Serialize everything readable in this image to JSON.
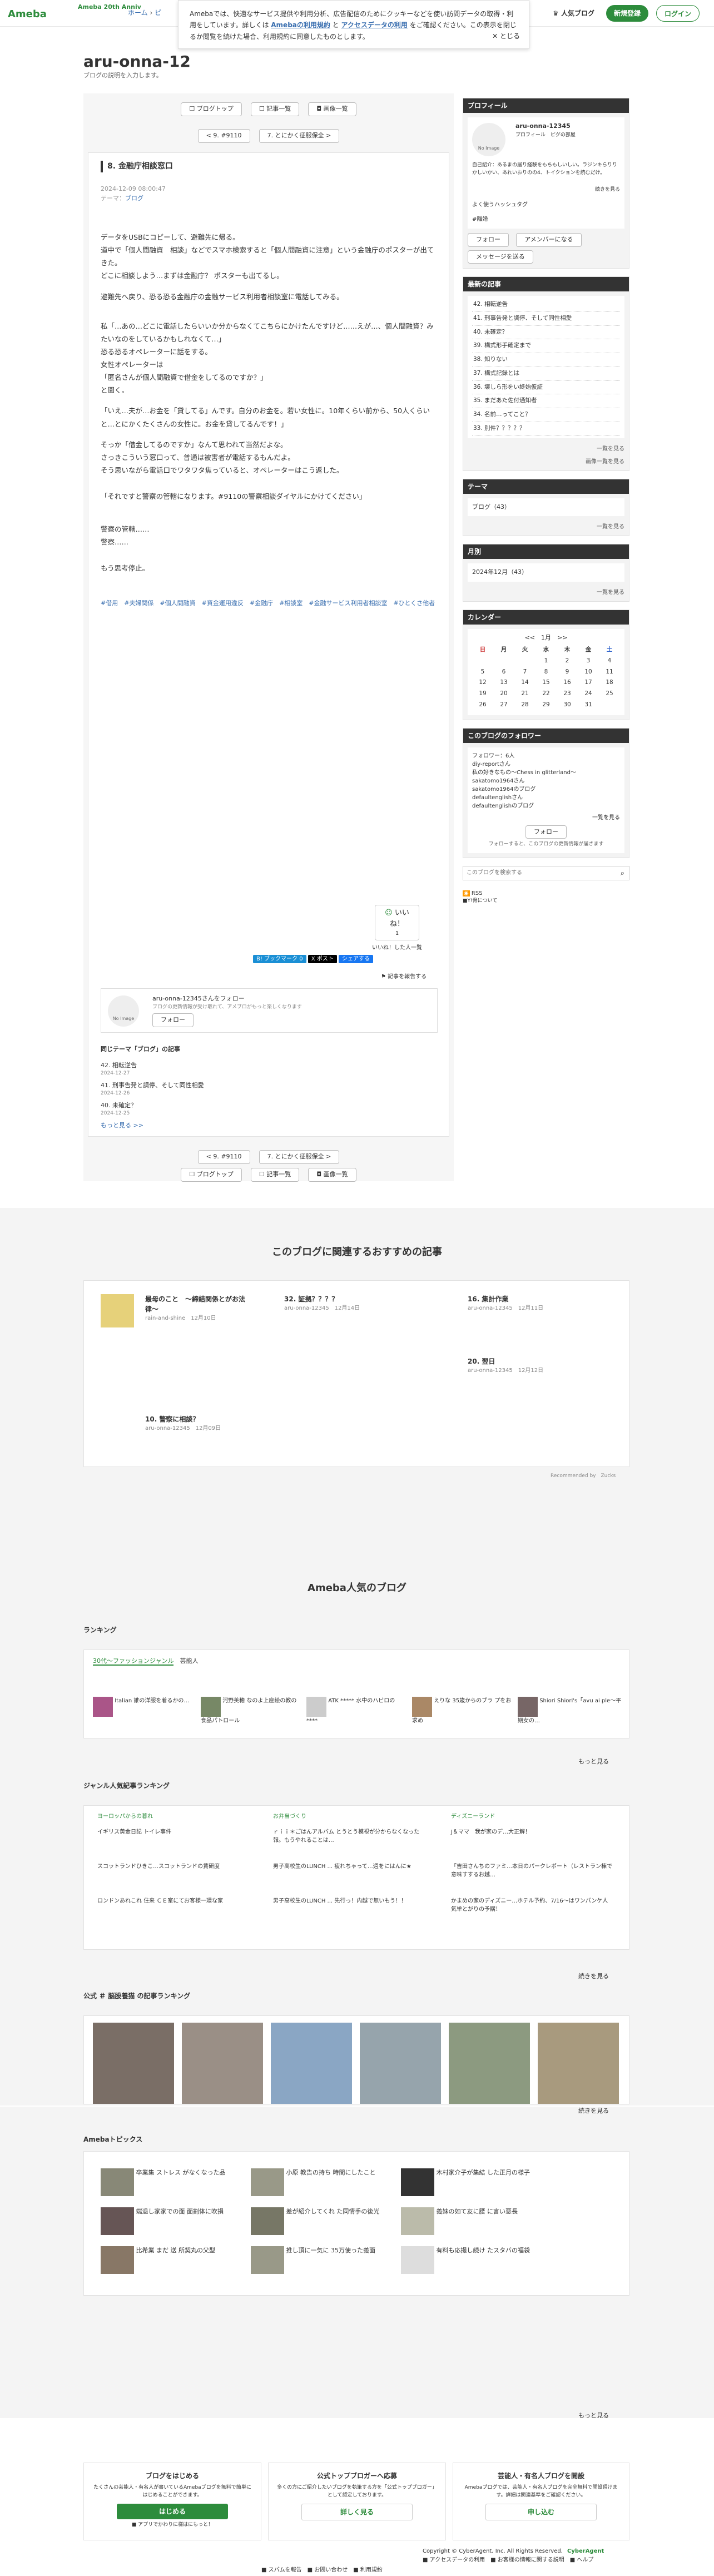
{
  "header": {
    "logo": "Ameba",
    "anniv": "Ameba 20th Anniv",
    "crumb_home": "ホーム",
    "crumb_more": "ピ",
    "btn_popular": "人気ブログ",
    "btn_signup": "新規登録",
    "btn_login": "ログイン"
  },
  "cookie": {
    "text_pre": "Amebaでは、快適なサービス提供や利用分析、広告配信のためにクッキーなどを使い訪問データの取得・利用をしています。詳しくは ",
    "link1": "Amebaの利用規約",
    "mid": " と ",
    "link2": "アクセスデータの利用",
    "text_post": " をご確認ください。この表示を閉じるか閲覧を続けた場合、利用規約に同意したものとします。",
    "close": "とじる"
  },
  "blog": {
    "title": "aru-onna-12",
    "desc": "ブログの説明を入力します。"
  },
  "nav": {
    "top": "ブログトップ",
    "list": "記事一覧",
    "images": "画像一覧",
    "prev": "< 9. #9110",
    "next": "7. とにかく征服保全 >"
  },
  "article": {
    "title": "8. 金融庁相談窓口",
    "date": "2024-12-09 08:00:47",
    "theme": "テーマ：",
    "theme_link": "ブログ",
    "p1": "データをUSBにコピーして、避難先に帰る。",
    "p2": "道中で「個人間融資　相談」などでスマホ検索すると「個人間融資に注意」という金融庁のポスターが出てきた。",
    "p3": "どこに相談しよう…まずは金融庁？ ポスターも出てるし。",
    "p4": "避難先へ戻り、恐る恐る金融庁の金融サービス利用者相談室に電話してみる。",
    "p5": "私「…あの…どこに電話したらいいか分からなくてこちらにかけたんですけど……えが…、個人間融資？みたいなのをしているかもしれなくて…」",
    "p6": "恐る恐るオペレーターに話をする。",
    "p7": "女性オペレーターは",
    "p8": "「匿名さんが個人間融資で借金をしてるのですか？」",
    "p9": "と聞く。",
    "p10": "「いえ…夫が…お金を「貸してる」んです。自分のお金を。若い女性に。10年くらい前から、50人くらいと…とにかくたくさんの女性に。お金を貸してるんです！」",
    "p11": "そっか「借金してるのですか」なんて思われて当然だよな。",
    "p12": "さっきこういう窓口って、普通は被害者が電話するもんだよ。",
    "p13": "そう思いながら電話口でワタワタ焦っていると、オペレーターはこう返した。",
    "p14": "「それですと警察の管轄になります。#9110の警察相談ダイヤルにかけてください」",
    "p15": "警察の管轄……",
    "p16": "警察……",
    "p17": "もう思考停止。",
    "tags": "#借用　#夫婦関係　#個人間融資　#資金運用違反　#金融庁　#相談室　#金融サービス利用者相談室　#ひとくさ他者",
    "like": "いいね！",
    "like_count": "1",
    "like_list": "いいね！した人一覧",
    "share1": "B! ブックマーク 0",
    "share2": "X ポスト",
    "share3": "シェアする",
    "report": "記事を報告する",
    "follow_text": "aru-onna-12345さんをフォロー",
    "follow_sub": "ブログの更新情報が受け取れて、アメブロがもっと楽しくなります",
    "follow_btn": "フォロー",
    "same_theme": "同じテーマ「ブログ」の記事",
    "rel": [
      {
        "t": "42. 相転逆告",
        "d": "2024-12-27"
      },
      {
        "t": "41. 刑事告発と調停、そして同性相愛",
        "d": "2024-12-26"
      },
      {
        "t": "40. 未確定？",
        "d": "2024-12-25"
      }
    ],
    "rel_more": "もっと見る >>"
  },
  "side": {
    "profile_h": "プロフィール",
    "user": "aru-onna-12345",
    "noimg": "No Image",
    "prof_links": "プロフィール　ピグの部屋",
    "intro": "自己紹介：あるまの居り経験をもちもしいしい。ラジンキらりりかしいかい、あれいおりのの4、トイクションを読むだけ。",
    "intro_more": "続きを見る",
    "hashtag": "よく使うハッシュタグ",
    "tag1": "#離婚",
    "btn_follow": "フォロー",
    "btn_amember": "アメンバーになる",
    "btn_msg": "メッセージを送る",
    "recent_h": "最新の記事",
    "recent": [
      "42. 相転逆告",
      "41. 刑事告発と調停、そして同性相愛",
      "40. 未確定？",
      "39. 構式形手確定まで",
      "38. 知りない",
      "37. 構式記録とは",
      "36. 壊しら形をい終始仮証",
      "35. まだあた佐付通知者",
      "34. 名前…ってこと？",
      "33. 別件？？？？？"
    ],
    "recent_more": "一覧を見る",
    "image_more": "画像一覧を見る",
    "theme_h": "テーマ",
    "theme_item": "ブログ（43）",
    "month_h": "月別",
    "month_item": "2024年12月（43）",
    "cal_h": "カレンダー",
    "cal_title": "<<　1月　>>",
    "cal_days": [
      "日",
      "月",
      "火",
      "水",
      "木",
      "金",
      "土"
    ],
    "cal_rows": [
      [
        "",
        "",
        "",
        "1",
        "2",
        "3",
        "4"
      ],
      [
        "5",
        "6",
        "7",
        "8",
        "9",
        "10",
        "11"
      ],
      [
        "12",
        "13",
        "14",
        "15",
        "16",
        "17",
        "18"
      ],
      [
        "19",
        "20",
        "21",
        "22",
        "23",
        "24",
        "25"
      ],
      [
        "26",
        "27",
        "28",
        "29",
        "30",
        "31",
        ""
      ]
    ],
    "fol_h": "このブログのフォロワー",
    "fol_count": "フォロワー：6人",
    "fols": [
      "diy-reportさん",
      "私の好きなもの〜Chess in glitterland〜",
      "sakatomo1964さん",
      "sakatomo1964のブログ",
      "defaultenglishさん",
      "defaultenglishのブログ"
    ],
    "fol_more": "一覧を見る",
    "fol_btn": "フォロー",
    "fol_note": "フォローすると、このブログの更新情報が届きます",
    "search_ph": "このブログを検索する",
    "rss": "RSS",
    "rss_note": "■Y!骨について"
  },
  "rec": {
    "title": "このブログに関連するおすすめの記事",
    "items": [
      {
        "t": "最母のこと　〜締結関係とがお法律〜",
        "a": "rain-and-shine　12月10日"
      },
      {
        "t": "32. 証拠？？？？",
        "a": "aru-onna-12345　12月14日"
      },
      {
        "t": "16. 集計作業",
        "a": "aru-onna-12345　12月11日"
      },
      {
        "t": "20. 翌日",
        "a": "aru-onna-12345　12月12日"
      },
      {
        "t": "10. 警察に相談？",
        "a": "aru-onna-12345　12月09日"
      }
    ],
    "by": "Recommended by　Zucks"
  },
  "popular": {
    "title": "Ameba人気のブログ",
    "ranking": "ランキング",
    "genre_tab1": "30代〜ファッションジャンル",
    "genre_tab2": "芸能人",
    "blogs": [
      {
        "n": "1",
        "t": "Italian 誰の洋服を着るかの…"
      },
      {
        "n": "2",
        "t": "河野美穂 なのよ上座絵の教の食品パトロール"
      },
      {
        "n": "3",
        "t": "ATK ***** 水中のハビロの ****"
      },
      {
        "n": "4",
        "t": "えりな 35歳からのブラ プをお求め"
      },
      {
        "n": "5",
        "t": "Shiori Shiori's「avu ai ple〜平期女の…"
      }
    ],
    "more": "もっと見る",
    "genre_title": "ジャンル人気記事ランキング",
    "cat1": "ヨーロッパからの暮れ",
    "cat2": "お弁当づくり",
    "cat3": "ディズニーランド",
    "c1": [
      "イギリス黄金日記 トイレ事件",
      "スコットランドひきこ…スコットランドの賃研度",
      "ロンドンあれこれ 住来 ＣＥ室にてお客様一環な家"
    ],
    "c2": [
      "ｒｉｉ＊ごはんアルバム とうとう模視が分からなくなった報。もうやれることは…",
      "男子高校生のLUNCH ... 疲れちゃって…週をにはんに★",
      "男子高校生のLUNCH ... 先行っ！内越で無いもう！！"
    ],
    "c3": [
      "J＆ママ　我が家のデ…大正解！",
      "「吉田さんちのファミ…本日のパークレポート（レストラン棟で意味すするお越…",
      "かまめの家のディズニー…ホテル予約、7/16〜はワンパンケ人気単とがりの予購！"
    ],
    "genre_more": "続きを見る",
    "official": "公式 ＃ 脳股養猫 の記事ランキング",
    "official_more": "続きを見る"
  },
  "topics": {
    "title": "Amebaトピックス",
    "items": [
      "卒業集 ストレス がなくなった品",
      "小原 教告の持ち 時間にしたこと",
      "木村家介子が集結 した正月の様子",
      "端退し家家での面 面割体に吹損",
      "差が紹介してくれ た同情手の後光",
      "義妹の如て友に腰 に言い悪長",
      "比希業 まだ 送 所契丸の父型",
      "推し頂に一気に 35万使った義面",
      "有料も応撮し続け たスタバの福袋"
    ],
    "more": "もっと見る"
  },
  "cta": {
    "c1_t": "ブログをはじめる",
    "c1_d": "たくさんの芸能人・有名人が書いているAmebaブログを無料で簡単にはじめることができます。",
    "c1_b": "はじめる",
    "c1_n": "■ アプリでかわりに様はにもっと！",
    "c2_t": "公式トップブロガーへ応募",
    "c2_d": "多くの方にご紹介したいブログを執筆する方を「公式トップブロガー」として認定しております。",
    "c2_b": "詳しく見る",
    "c3_t": "芸能人・有名人ブログを開設",
    "c3_d": "Amebaブログでは、芸能人・有名人ブログを完全無料で開設頂けます。詳細は関連基準をご確認ください。",
    "c3_b": "申し込む"
  },
  "footer": {
    "copy": "Copyright © CyberAgent, Inc. All Rights Reserved.",
    "brand": "CyberAgent",
    "links": "■ アクセスデータの利用　■ お客様の情報に関する説明　■ ヘルプ",
    "links2": "■ スパムを報告　■ お問い合わせ　■ 利用規約"
  }
}
